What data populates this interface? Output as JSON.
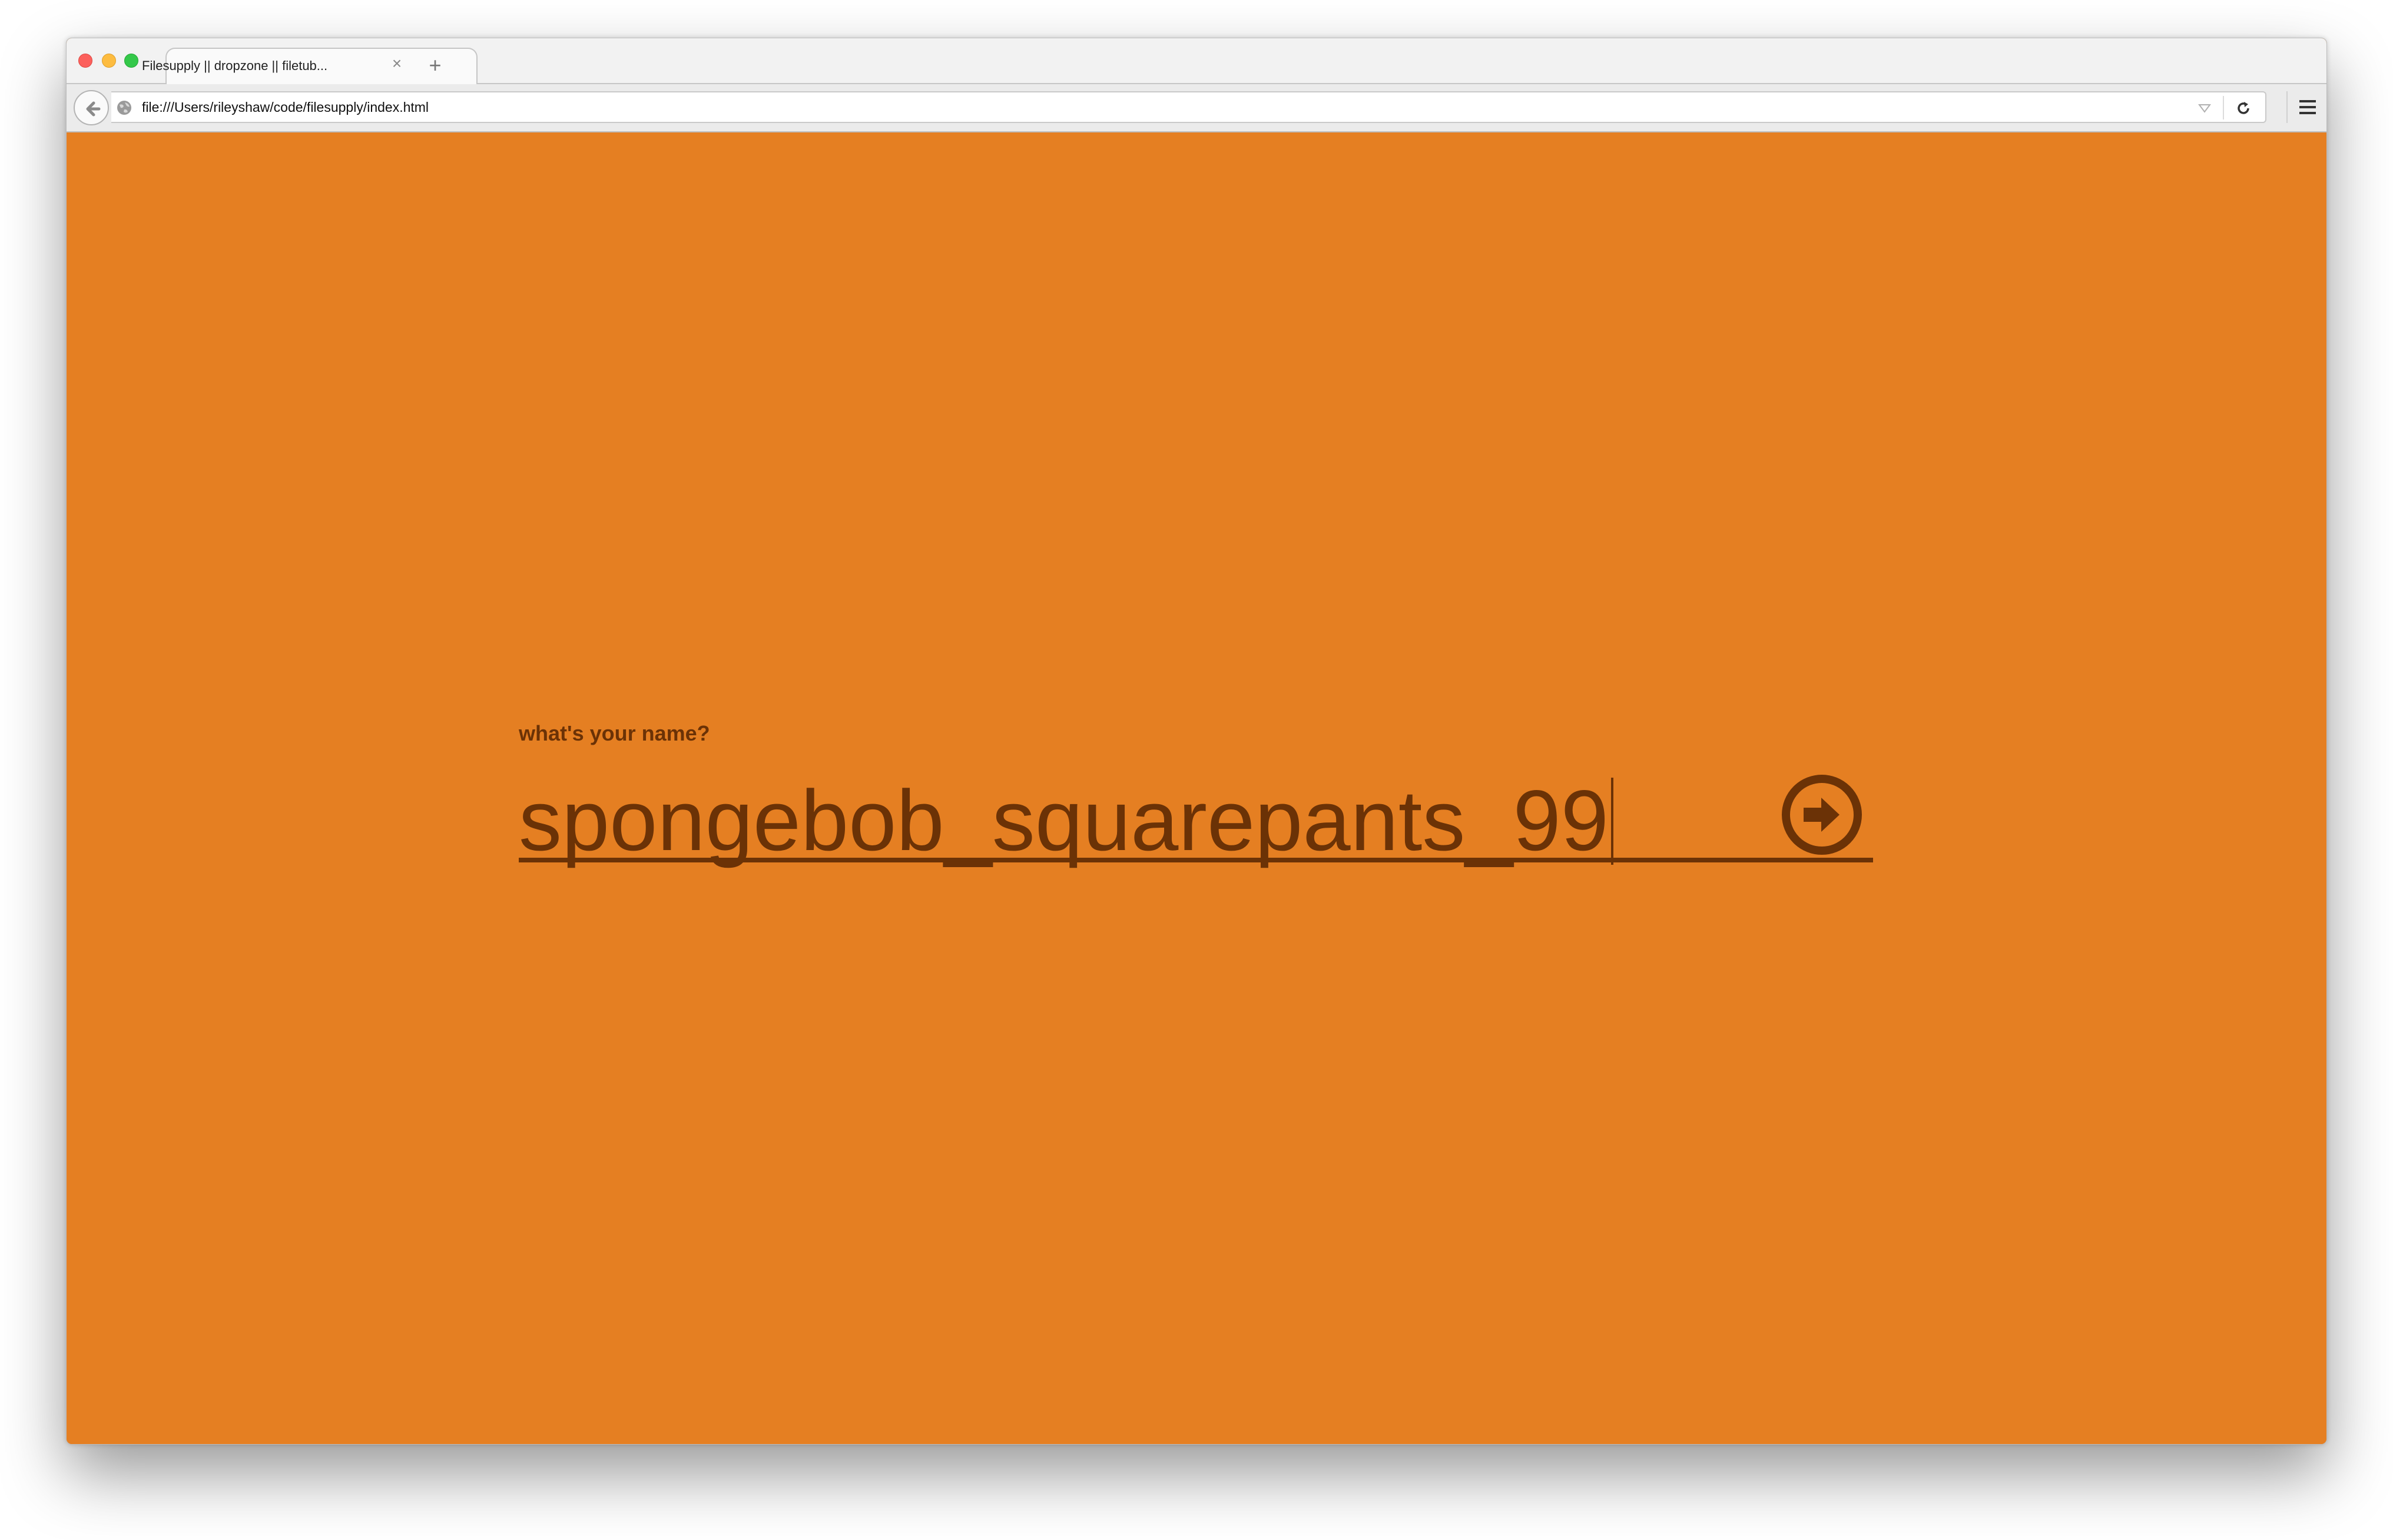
{
  "browser": {
    "tab_title": "Filesupply || dropzone || filetub...",
    "tab_close_icon": "close-icon",
    "new_tab_icon": "plus-icon",
    "url": "file:///Users/rileyshaw/code/filesupply/index.html",
    "back_icon": "arrow-left-icon",
    "site_icon": "globe-icon",
    "dropdown_icon": "chevron-down-icon",
    "reload_icon": "reload-icon",
    "menu_icon": "hamburger-menu-icon"
  },
  "page": {
    "background_color": "#e57f22",
    "accent_color": "#6b3206",
    "prompt_label": "what's your name?",
    "name_value": "spongebob_squarepants_99",
    "submit_icon": "arrow-circle-right-icon"
  }
}
